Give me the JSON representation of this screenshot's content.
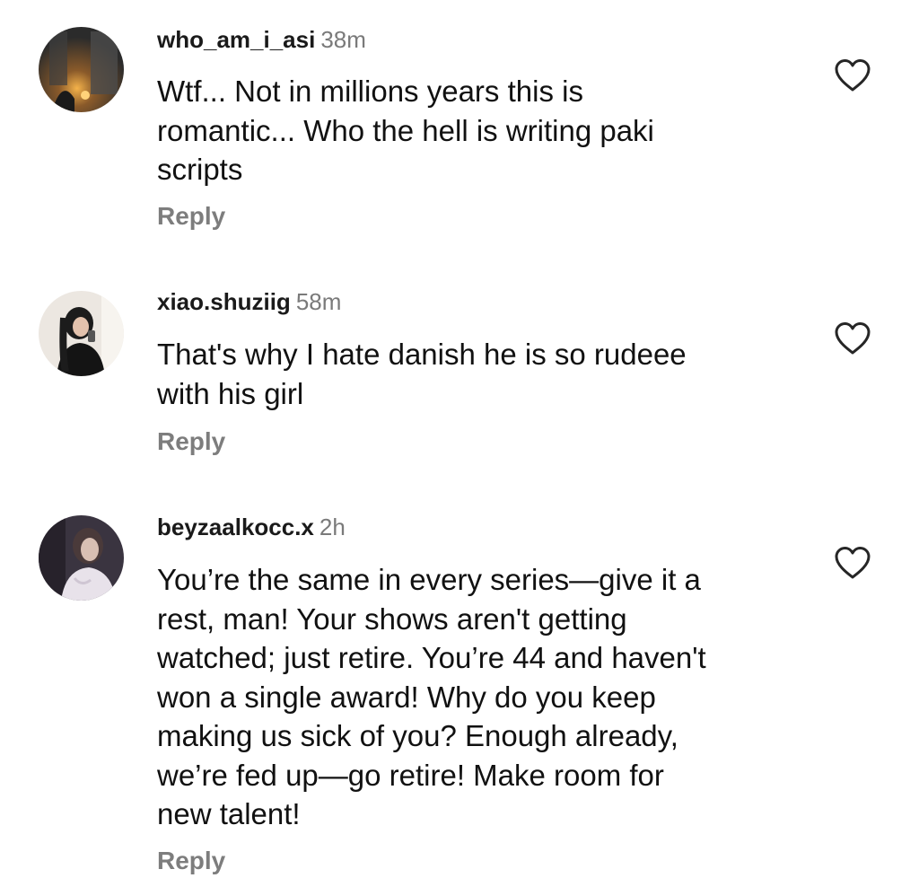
{
  "comments": [
    {
      "username": "who_am_i_asi",
      "time": "38m",
      "lines": [
        "Wtf... Not in millions years this is",
        "romantic... Who the hell is writing paki",
        "scripts"
      ],
      "reply_label": "Reply",
      "like_icon": "heart-outline-icon"
    },
    {
      "username": "xiao.shuziig",
      "time": "58m",
      "lines": [
        "That's why I hate danish he is so rudeee",
        "with his girl"
      ],
      "reply_label": "Reply",
      "like_icon": "heart-outline-icon"
    },
    {
      "username": "beyzaalkocc.x",
      "time": "2h",
      "lines": [
        "You’re the same in every series—give it a",
        "rest, man! Your shows aren't getting",
        "watched; just retire. You’re 44 and haven't",
        "won a single award! Why do you keep",
        "making us sick of you? Enough already,",
        "we’re fed up—go retire! Make room for",
        "new talent!"
      ],
      "reply_label": "Reply",
      "like_icon": "heart-outline-icon"
    }
  ],
  "colors": {
    "text": "#111111",
    "muted": "#7a7a7a",
    "icon": "#262626",
    "background": "#ffffff"
  }
}
